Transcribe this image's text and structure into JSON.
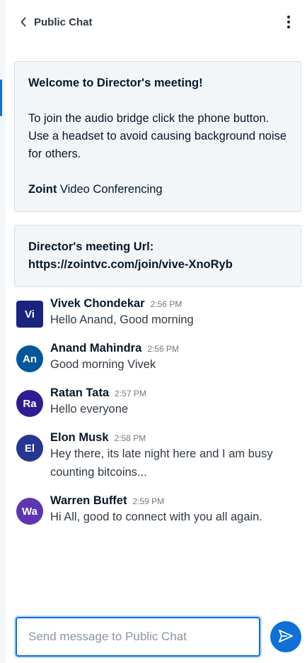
{
  "header": {
    "title": "Public Chat"
  },
  "welcome": {
    "line1_prefix": "Welcome to ",
    "meeting_name": "Director's meeting",
    "line1_suffix": "!",
    "instructions": "To join the audio bridge click the phone button. Use a headset to avoid causing background noise for others.",
    "brand": "Zoint",
    "brand_suffix": " Video Conferencing"
  },
  "url_box": {
    "label": "Director's meeting Url:",
    "url": "https://zointvc.com/join/vive-XnoRyb"
  },
  "messages": [
    {
      "initials": "Vi",
      "sender": "Vivek Chondekar",
      "time": "2:56 PM",
      "text": "Hello Anand, Good morning",
      "color": "#1a237e"
    },
    {
      "initials": "An",
      "sender": "Anand Mahindra",
      "time": "2:56 PM",
      "text": "Good morning Vivek",
      "color": "#01579b"
    },
    {
      "initials": "Ra",
      "sender": "Ratan Tata",
      "time": "2:57 PM",
      "text": "Hello everyone",
      "color": "#311b92"
    },
    {
      "initials": "El",
      "sender": "Elon Musk",
      "time": "2:58 PM",
      "text": "Hey there, its late night here and I am busy counting bitcoins...",
      "color": "#283593"
    },
    {
      "initials": "Wa",
      "sender": "Warren Buffet",
      "time": "2:59 PM",
      "text": "Hi All, good to connect with you all again.",
      "color": "#5e35b1"
    }
  ],
  "composer": {
    "placeholder": "Send message to Public Chat",
    "value": ""
  },
  "icons": {
    "back": "chevron-left-icon",
    "more": "more-vertical-icon",
    "send": "send-icon"
  },
  "colors": {
    "accent": "#0f70d7",
    "panel_bg": "#f3f6f9"
  }
}
